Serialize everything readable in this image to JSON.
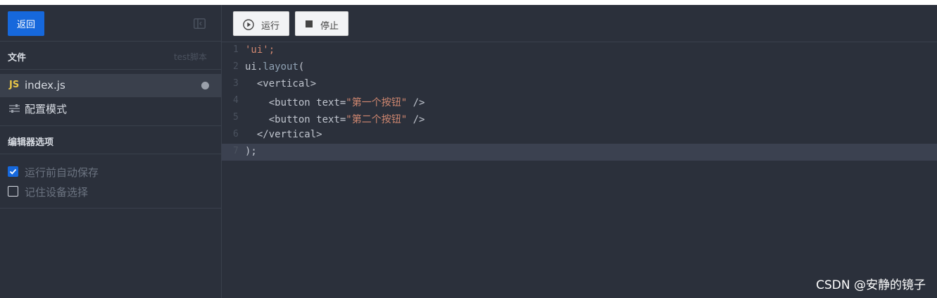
{
  "sidebar": {
    "back_label": "返回",
    "files_title": "文件",
    "project_name": "test脚本",
    "files": [
      {
        "badge": "JS",
        "name": "index.js"
      }
    ],
    "config_label": "配置模式",
    "editor_options_title": "编辑器选项",
    "options": [
      {
        "label": "运行前自动保存",
        "checked": true
      },
      {
        "label": "记住设备选择",
        "checked": false
      }
    ]
  },
  "toolbar": {
    "run_label": "运行",
    "stop_label": "停止"
  },
  "editor": {
    "line_numbers": [
      "1",
      "2",
      "3",
      "4",
      "5",
      "6",
      "7"
    ],
    "lines": [
      "'ui';",
      "ui.layout(",
      "  <vertical>",
      "    <button text=\"第一个按钮\" />",
      "    <button text=\"第二个按钮\" />",
      "  </vertical>",
      ");"
    ],
    "current_line": 7
  },
  "watermark": "CSDN @安静的镜子",
  "colors": {
    "background": "#2b303b",
    "accent": "#1668dc",
    "string": "#d08770"
  }
}
